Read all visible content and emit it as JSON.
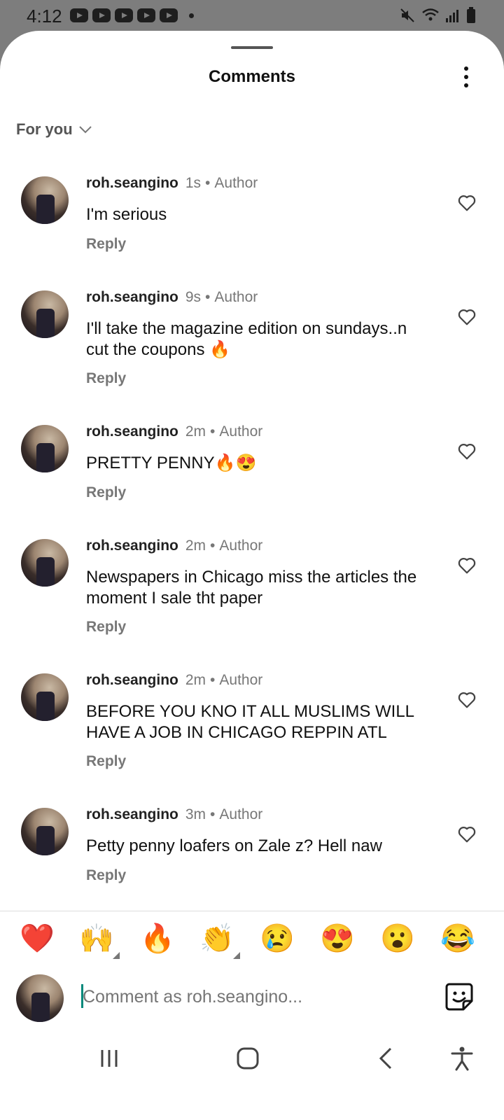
{
  "status_bar": {
    "time": "4:12"
  },
  "header": {
    "title": "Comments"
  },
  "filter": {
    "label": "For you"
  },
  "comments": [
    {
      "username": "roh.seangino",
      "time": "1s",
      "badge": "Author",
      "text": "I'm serious",
      "reply_label": "Reply"
    },
    {
      "username": "roh.seangino",
      "time": "9s",
      "badge": "Author",
      "text": "I'll take the magazine edition on sundays..n cut the coupons 🔥",
      "reply_label": "Reply"
    },
    {
      "username": "roh.seangino",
      "time": "2m",
      "badge": "Author",
      "text": "PRETTY PENNY🔥😍",
      "reply_label": "Reply"
    },
    {
      "username": "roh.seangino",
      "time": "2m",
      "badge": "Author",
      "text": "Newspapers in Chicago miss the articles the moment I sale tht paper",
      "reply_label": "Reply"
    },
    {
      "username": "roh.seangino",
      "time": "2m",
      "badge": "Author",
      "text": "BEFORE YOU KNO IT ALL MUSLIMS WILL HAVE A JOB IN CHICAGO REPPIN ATL",
      "reply_label": "Reply"
    },
    {
      "username": "roh.seangino",
      "time": "3m",
      "badge": "Author",
      "text": "Petty penny loafers on Zale z? Hell naw",
      "reply_label": "Reply"
    }
  ],
  "emoji_bar": [
    "❤️",
    "🙌",
    "🔥",
    "👏",
    "😢",
    "😍",
    "😮",
    "😂"
  ],
  "composer": {
    "placeholder": "Comment as roh.seangino..."
  },
  "icons": {
    "more": "more-vertical-icon",
    "filter": "chevron-down-icon",
    "like": "heart-outline-icon",
    "sticker": "sticker-icon",
    "nav": [
      "recent-apps-icon",
      "home-icon",
      "back-icon",
      "accessibility-icon"
    ]
  }
}
